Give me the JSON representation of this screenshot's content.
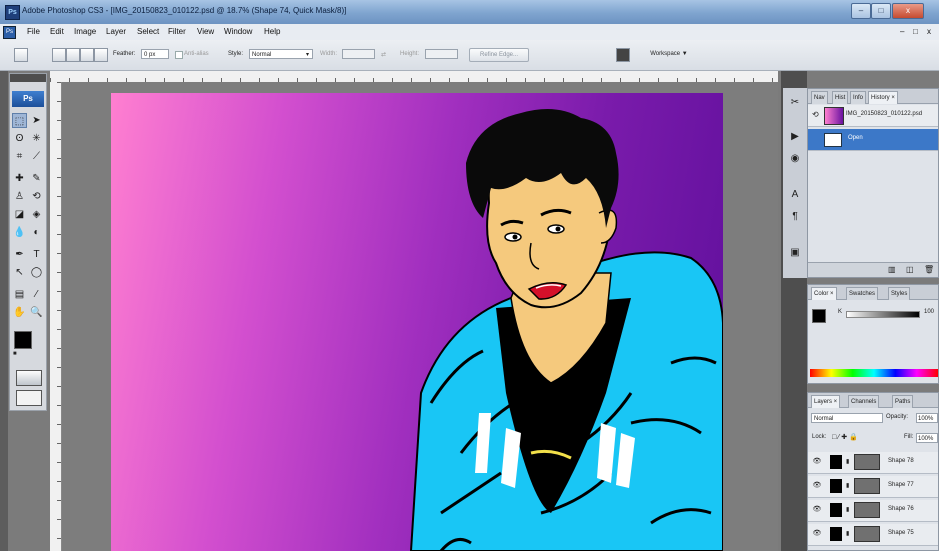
{
  "window": {
    "title": "Adobe Photoshop CS3 - [IMG_20150823_010122.psd @ 18.7% (Shape 74, Quick Mask/8)]",
    "app_icon": "Ps",
    "controls": {
      "minimize": "–",
      "maximize": "□",
      "close": "x"
    }
  },
  "menu": {
    "items": [
      "File",
      "Edit",
      "Image",
      "Layer",
      "Select",
      "Filter",
      "View",
      "Window",
      "Help"
    ],
    "doc_controls": [
      "–",
      "□",
      "x"
    ]
  },
  "options": {
    "feather_label": "Feather:",
    "feather_value": "0 px",
    "antialias_label": "Anti-alias",
    "style_label": "Style:",
    "style_value": "Normal",
    "width_label": "Width:",
    "height_label": "Height:",
    "refine_edge": "Refine Edge...",
    "workspace": "Workspace ▼"
  },
  "toolbox": {
    "badge": "Ps"
  },
  "history": {
    "tabs": [
      "Nav",
      "Hist",
      "Info",
      "History ×"
    ],
    "snapshot": "IMG_20150823_010122.psd",
    "state": "Open"
  },
  "color_panel": {
    "tabs": [
      "Color ×",
      "Swatches",
      "Styles"
    ],
    "channel": "K",
    "value": "100"
  },
  "layers": {
    "tabs": [
      "Layers ×",
      "Channels",
      "Paths"
    ],
    "blend": "Normal",
    "opacity_label": "Opacity:",
    "opacity": "100%",
    "lock_label": "Lock:",
    "fill_label": "Fill:",
    "fill": "100%",
    "items": [
      "Shape 78",
      "Shape 77",
      "Shape 76",
      "Shape 75"
    ]
  },
  "colors": {
    "accent": "#3c78c8",
    "gradient_left": "#ff7fd0",
    "gradient_right": "#5f0f9c",
    "hoodie": "#19c6f5",
    "skin": "#f5c97d"
  }
}
